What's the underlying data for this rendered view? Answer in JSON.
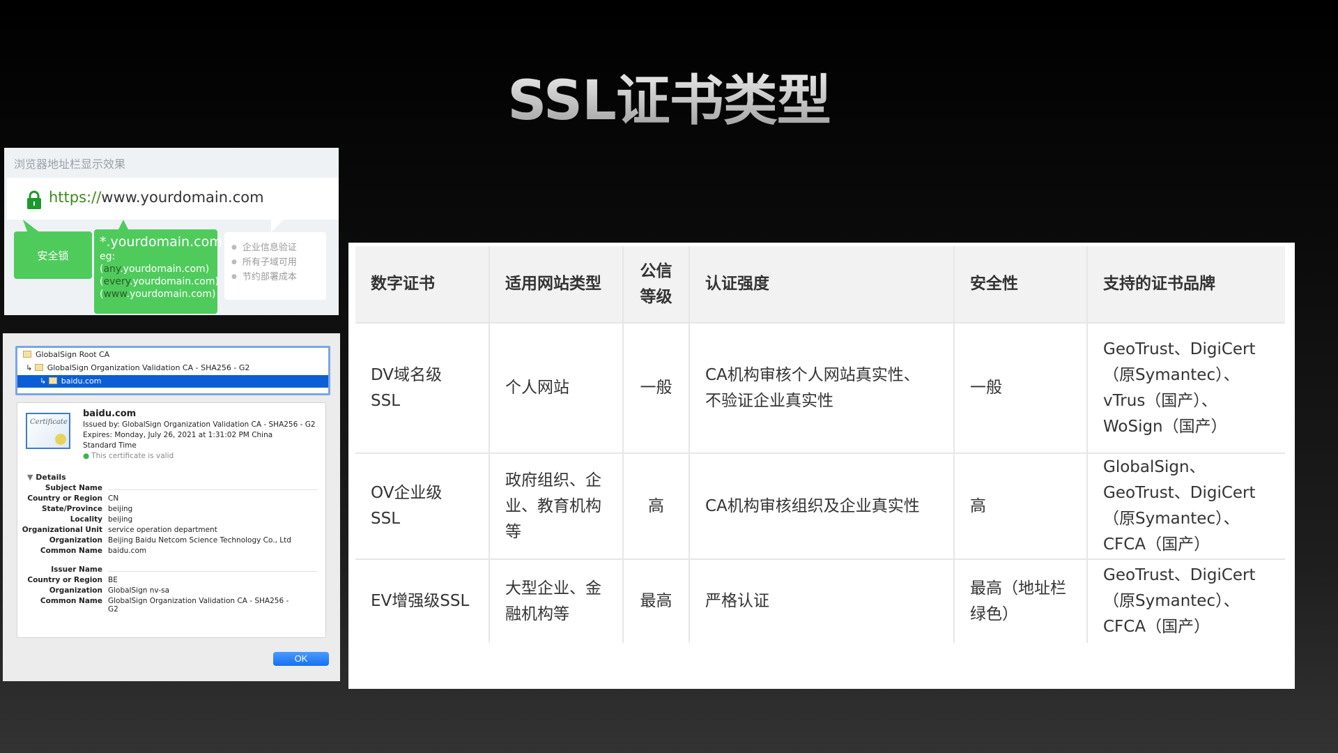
{
  "title": "SSL证书类型",
  "browser_panel": {
    "heading": "浏览器地址栏显示效果",
    "url_scheme": "https://",
    "url_host": "www.yourdomain.com",
    "lock_label": "安全锁",
    "wildcard": {
      "domain": "*.yourdomain.com",
      "eg": "eg:",
      "examples": [
        {
          "sub": "any",
          "rest": ".yourdomain.com"
        },
        {
          "sub": "every",
          "rest": ".yourdomain.com"
        },
        {
          "sub": "www",
          "rest": ".yourdomain.com"
        }
      ]
    },
    "features": [
      "企业信息验证",
      "所有子域可用",
      "节约部署成本"
    ]
  },
  "cert_dialog": {
    "chain": [
      "GlobalSign Root CA",
      "GlobalSign Organization Validation CA - SHA256 - G2",
      "baidu.com"
    ],
    "name": "baidu.com",
    "issued_by": "Issued by: GlobalSign Organization Validation CA - SHA256 - G2",
    "expires": "Expires: Monday, July 26, 2021 at 1:31:02 PM China",
    "expires2": "Standard Time",
    "valid": "This certificate is valid",
    "details_label": "Details",
    "cert_image_text": "Certificate",
    "subject_header": "Subject Name",
    "subject": [
      [
        "Country or Region",
        "CN"
      ],
      [
        "State/Province",
        "beijing"
      ],
      [
        "Locality",
        "beijing"
      ],
      [
        "Organizational Unit",
        "service operation department"
      ],
      [
        "Organization",
        "Beijing Baidu Netcom Science Technology Co., Ltd"
      ],
      [
        "Common Name",
        "baidu.com"
      ]
    ],
    "issuer_header": "Issuer Name",
    "issuer": [
      [
        "Country or Region",
        "BE"
      ],
      [
        "Organization",
        "GlobalSign nv-sa"
      ],
      [
        "Common Name",
        "GlobalSign Organization Validation CA - SHA256 -"
      ]
    ],
    "issuer_cn_wrap": "G2",
    "ok_label": "OK"
  },
  "table": {
    "headers": [
      "数字证书",
      "适用网站类型",
      "公信\n等级",
      "认证强度",
      "安全性",
      "支持的证书品牌"
    ],
    "rows": [
      [
        "DV域名级\nSSL",
        "个人网站",
        "一般",
        "CA机构审核个人网站真实性、\n不验证企业真实性",
        "一般",
        "GeoTrust、DigiCert\n（原Symantec）、\nvTrus（国产）、\nWoSign（国产）"
      ],
      [
        "OV企业级\nSSL",
        "政府组织、企\n业、教育机构\n等",
        "高",
        "CA机构审核组织及企业真实性",
        "高",
        "GlobalSign、\nGeoTrust、DigiCert\n（原Symantec）、\nCFCA（国产）"
      ],
      [
        "EV增强级SSL",
        "大型企业、金\n融机构等",
        "最高",
        "严格认证",
        "最高（地址栏\n绿色）",
        "GeoTrust、DigiCert\n（原Symantec）、\nCFCA（国产）"
      ]
    ]
  }
}
